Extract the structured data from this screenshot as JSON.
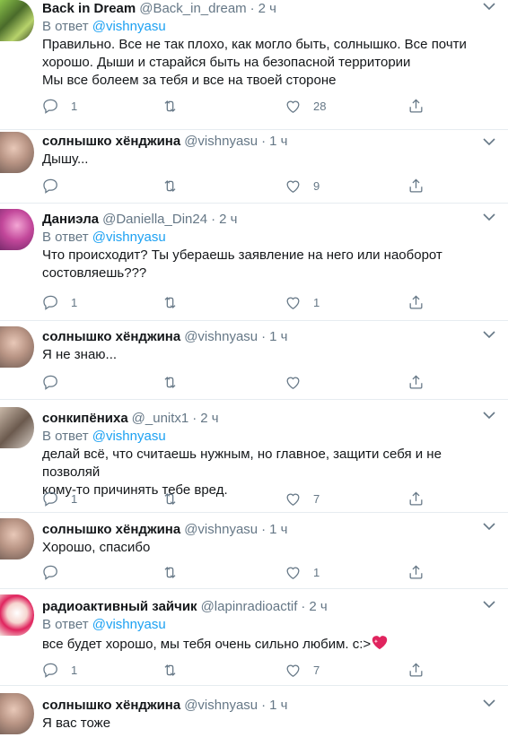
{
  "tweets": [
    {
      "name": "Back in Dream",
      "handle": "@Back_in_dream",
      "dot": "·",
      "time": "2 ч",
      "reply_prefix": "В ответ",
      "reply_to": "@vishnyasu",
      "lines": [
        "Правильно. Все не так плохо, как могло быть, солнышко. Все почти",
        "хорошо. Дыши и старайся быть на безопасной территории",
        "Мы все болеем за тебя и все на твоей стороне"
      ],
      "replies": "1",
      "retweets": "",
      "likes": "28"
    },
    {
      "name": "солнышко хёнджина",
      "handle": "@vishnyasu",
      "dot": "·",
      "time": "1 ч",
      "lines": [
        "Дышу..."
      ],
      "replies": "",
      "retweets": "",
      "likes": "9"
    },
    {
      "name": "Даниэла",
      "handle": "@Daniella_Din24",
      "dot": "·",
      "time": "2 ч",
      "reply_prefix": "В ответ",
      "reply_to": "@vishnyasu",
      "lines": [
        "Что происходит? Ты убераешь заявление на него или наоборот",
        "состовляешь???"
      ],
      "replies": "1",
      "retweets": "",
      "likes": "1"
    },
    {
      "name": "солнышко хёнджина",
      "handle": "@vishnyasu",
      "dot": "·",
      "time": "1 ч",
      "lines": [
        "Я не знаю..."
      ],
      "replies": "",
      "retweets": "",
      "likes": ""
    },
    {
      "name": "сонкипёниха",
      "handle": "@_unitx1",
      "dot": "·",
      "time": "2 ч",
      "reply_prefix": "В ответ",
      "reply_to": "@vishnyasu",
      "lines": [
        "делай всё, что считаешь нужным, но главное, защити себя и не позволяй",
        "кому-то причинять тебе вред."
      ],
      "replies": "1",
      "retweets": "",
      "likes": "7"
    },
    {
      "name": "солнышко хёнджина",
      "handle": "@vishnyasu",
      "dot": "·",
      "time": "1 ч",
      "lines": [
        "Хорошо, спасибо"
      ],
      "replies": "",
      "retweets": "",
      "likes": "1"
    },
    {
      "name": "радиоактивный зайчик",
      "handle": "@lapinradioactif",
      "dot": "·",
      "time": "2 ч",
      "reply_prefix": "В ответ",
      "reply_to": "@vishnyasu",
      "lines": [
        "все будет хорошо, мы тебя очень сильно любим. с:>"
      ],
      "replies": "1",
      "retweets": "",
      "likes": "7"
    },
    {
      "name": "солнышко хёнджина",
      "handle": "@vishnyasu",
      "dot": "·",
      "time": "1 ч",
      "lines": [
        "Я вас тоже"
      ],
      "replies": "",
      "retweets": "",
      "likes": ""
    }
  ],
  "colors": {
    "accent": "#1da1f2",
    "secondary_text": "#657786",
    "divider": "#e6ecf0",
    "heart_emoji": "#e0245e"
  },
  "icons": {
    "reply": "speech-bubble-icon",
    "retweet": "retweet-icon",
    "like": "heart-icon",
    "share": "share-icon",
    "more": "chevron-down-icon"
  }
}
